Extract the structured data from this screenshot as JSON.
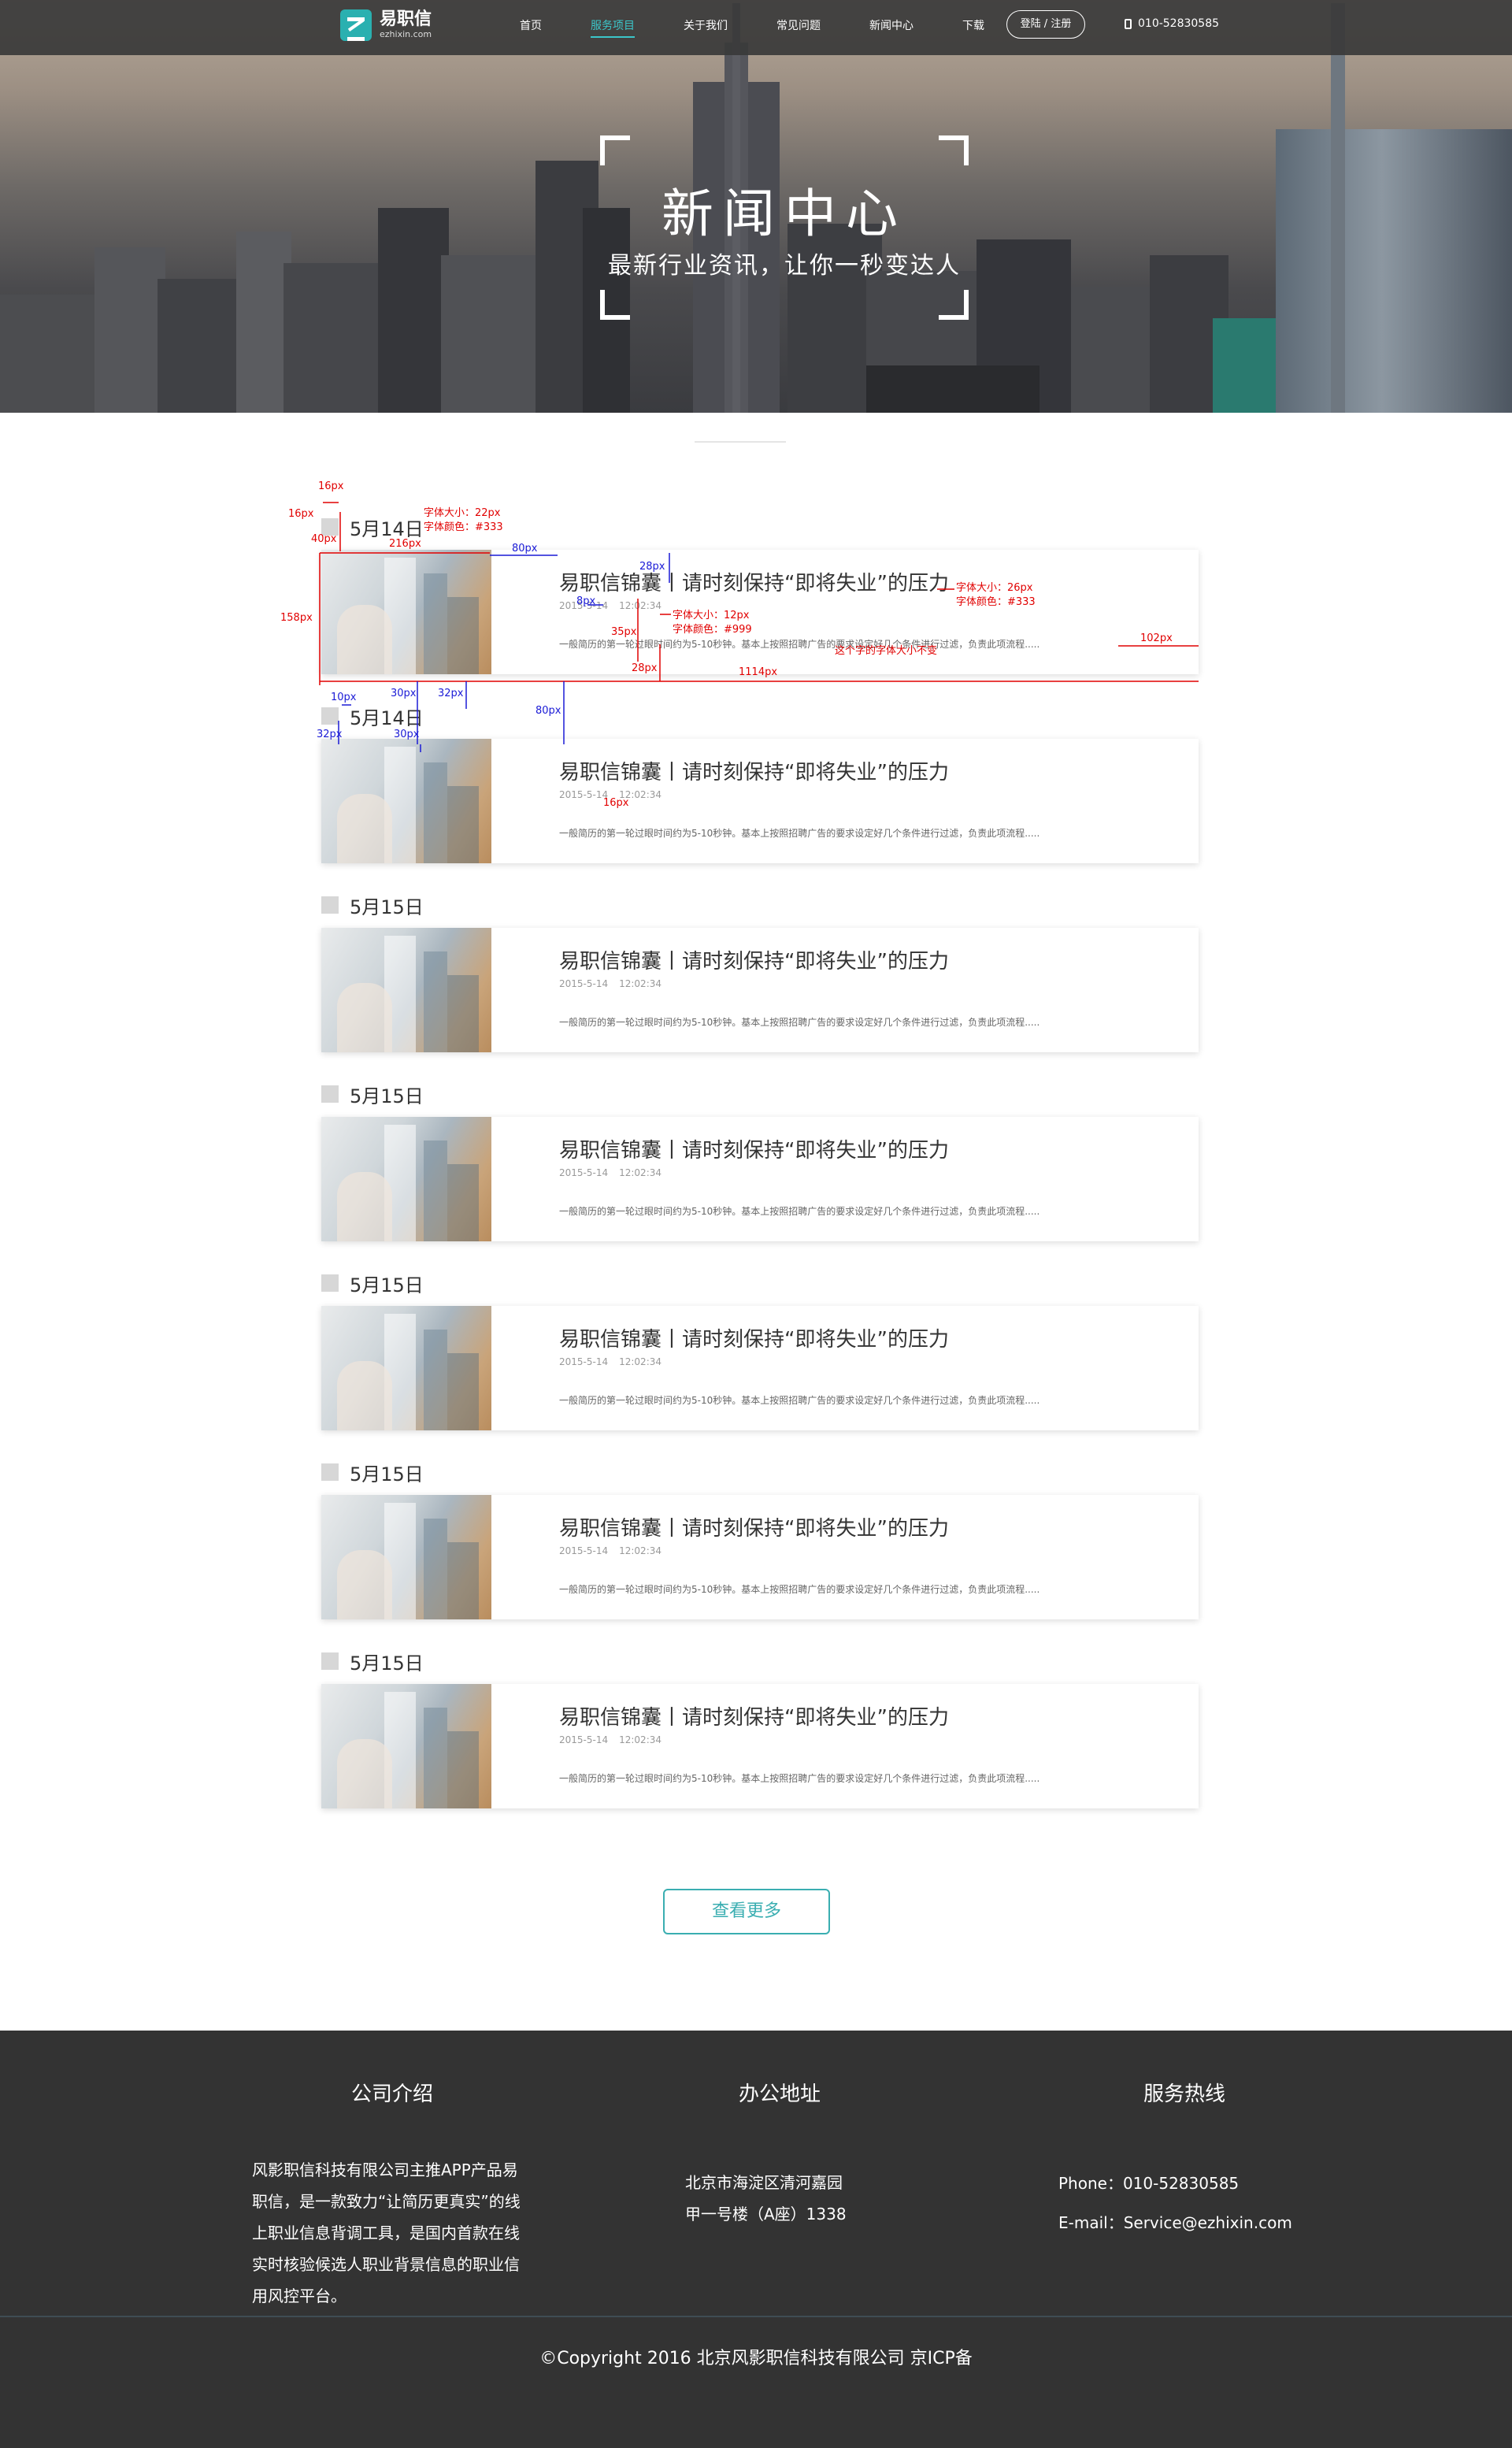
{
  "brand": {
    "name": "易职信",
    "domain": "ezhixin.com"
  },
  "nav": {
    "items": [
      {
        "label": "首页",
        "active": false
      },
      {
        "label": "服务项目",
        "active": true
      },
      {
        "label": "关于我们",
        "active": false
      },
      {
        "label": "常见问题",
        "active": false
      },
      {
        "label": "新闻中心",
        "active": false
      },
      {
        "label": "下载",
        "active": false
      }
    ],
    "login_label": "登陆 / 注册",
    "phone": "010-52830585"
  },
  "hero": {
    "title": "新闻中心",
    "subtitle": "最新行业资讯，让你一秒变达人"
  },
  "news": [
    {
      "date": "5月14日",
      "title": "易职信锦囊丨请时刻保持“即将失业”的压力",
      "date_meta": "2015-5-14",
      "time_meta": "12:02:34",
      "desc": "一般简历的第一轮过眼时间约为5-10秒钟。基本上按照招聘广告的要求设定好几个条件进行过滤，负责此项流程....."
    },
    {
      "date": "5月14日",
      "title": "易职信锦囊丨请时刻保持“即将失业”的压力",
      "date_meta": "2015-5-14",
      "time_meta": "12:02:34",
      "desc": "一般简历的第一轮过眼时间约为5-10秒钟。基本上按照招聘广告的要求设定好几个条件进行过滤，负责此项流程....."
    },
    {
      "date": "5月15日",
      "title": "易职信锦囊丨请时刻保持“即将失业”的压力",
      "date_meta": "2015-5-14",
      "time_meta": "12:02:34",
      "desc": "一般简历的第一轮过眼时间约为5-10秒钟。基本上按照招聘广告的要求设定好几个条件进行过滤，负责此项流程....."
    },
    {
      "date": "5月15日",
      "title": "易职信锦囊丨请时刻保持“即将失业”的压力",
      "date_meta": "2015-5-14",
      "time_meta": "12:02:34",
      "desc": "一般简历的第一轮过眼时间约为5-10秒钟。基本上按照招聘广告的要求设定好几个条件进行过滤，负责此项流程....."
    },
    {
      "date": "5月15日",
      "title": "易职信锦囊丨请时刻保持“即将失业”的压力",
      "date_meta": "2015-5-14",
      "time_meta": "12:02:34",
      "desc": "一般简历的第一轮过眼时间约为5-10秒钟。基本上按照招聘广告的要求设定好几个条件进行过滤，负责此项流程....."
    },
    {
      "date": "5月15日",
      "title": "易职信锦囊丨请时刻保持“即将失业”的压力",
      "date_meta": "2015-5-14",
      "time_meta": "12:02:34",
      "desc": "一般简历的第一轮过眼时间约为5-10秒钟。基本上按照招聘广告的要求设定好几个条件进行过滤，负责此项流程....."
    },
    {
      "date": "5月15日",
      "title": "易职信锦囊丨请时刻保持“即将失业”的压力",
      "date_meta": "2015-5-14",
      "time_meta": "12:02:34",
      "desc": "一般简历的第一轮过眼时间约为5-10秒钟。基本上按照招聘广告的要求设定好几个条件进行过滤，负责此项流程....."
    }
  ],
  "annotations": {
    "a16px_1": "16px",
    "a16px_2": "16px",
    "a40px": "40px",
    "a216px": "216px",
    "a80px": "80px",
    "a158px": "158px",
    "a28px": "28px",
    "a8px": "8px",
    "a35px": "35px",
    "a28px_b": "28px",
    "a1114px": "1114px",
    "a102px": "102px",
    "a10px": "10px",
    "a30px": "30px",
    "a32px": "32px",
    "a80px_b": "80px",
    "a32px_b": "32px",
    "a30px_b": "30px",
    "a16px_3": "16px",
    "date_font": "字体大小：22px",
    "date_color": "字体颜色：#333",
    "title_font": "字体大小：26px",
    "title_color": "字体颜色：#333",
    "meta_font": "字体大小：12px",
    "meta_color": "字体颜色：#999",
    "desc_note": "这个字的字体大小不变"
  },
  "more_label": "查看更多",
  "footer": {
    "about_title": "公司介绍",
    "about_text": "风影职信科技有限公司主推APP产品易职信，是一款致力“让简历更真实”的线上职业信息背调工具，是国内首款在线实时核验候选人职业背景信息的职业信用风控平台。",
    "address_title": "办公地址",
    "address_line1": "北京市海淀区清河嘉园",
    "address_line2": "甲一号楼（A座）1338",
    "hotline_title": "服务热线",
    "phone_line": "Phone：010-52830585",
    "email_line": "E-mail：Service@ezhixin.com",
    "copyright": "©Copyright 2016 北京风影职信科技有限公司 京ICP备"
  },
  "colors": {
    "accent": "#3bc6c9",
    "button": "#3aaeb1",
    "footer_bg": "#333333",
    "annotation_red": "#e10000",
    "annotation_blue": "#1a1ad6"
  }
}
